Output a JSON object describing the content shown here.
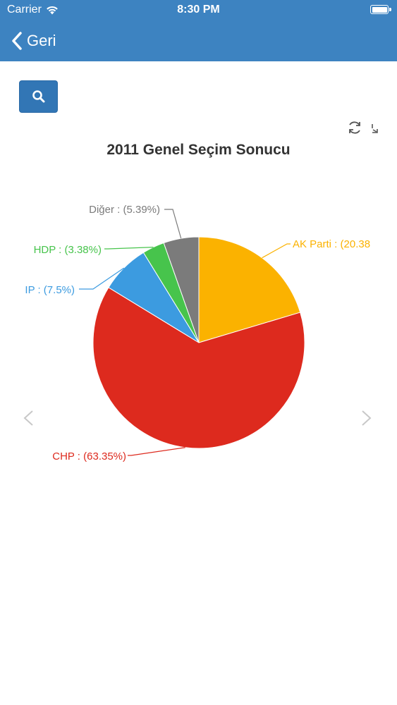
{
  "status_bar": {
    "carrier": "Carrier",
    "time": "8:30 PM"
  },
  "nav": {
    "back_label": "Geri"
  },
  "colors": {
    "header": "#3d83c1",
    "button": "#3276b5"
  },
  "icons": {
    "back": "chevron-left-icon",
    "search": "search-icon",
    "refresh": "refresh-icon",
    "expand": "expand-icon",
    "prev": "chevron-left-icon",
    "next": "chevron-right-icon"
  },
  "chart_data": {
    "type": "pie",
    "title": "2011 Genel Seçim Sonucu",
    "slices": [
      {
        "name": "AK Parti",
        "value": 20.38,
        "label": "AK Parti :  (20.38",
        "color": "#fbb200"
      },
      {
        "name": "CHP",
        "value": 63.35,
        "label": "CHP :  (63.35%)",
        "color": "#dd2a1e"
      },
      {
        "name": "IP",
        "value": 7.5,
        "label": "IP :  (7.5%)",
        "color": "#3c9be0"
      },
      {
        "name": "HDP",
        "value": 3.38,
        "label": "HDP :  (3.38%)",
        "color": "#47c44c"
      },
      {
        "name": "Diğer",
        "value": 5.39,
        "label": "Diğer :  (5.39%)",
        "color": "#7b7b7b"
      }
    ]
  }
}
